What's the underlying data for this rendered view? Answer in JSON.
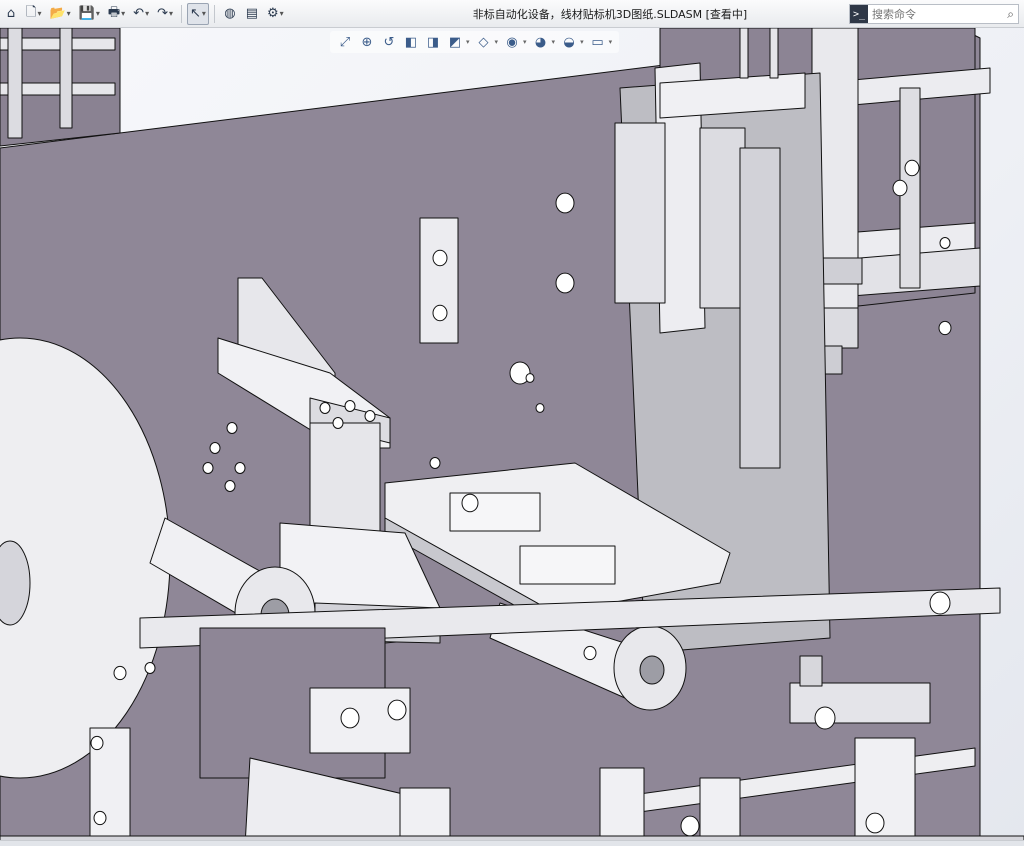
{
  "window": {
    "title": "非标自动化设备，线材贴标机3D图纸.SLDASM [查看中]"
  },
  "toolbar": {
    "items": [
      {
        "name": "home-icon",
        "glyph": "⌂",
        "caret": false
      },
      {
        "name": "new-document-icon",
        "glyph": "🗋",
        "caret": true
      },
      {
        "name": "open-folder-icon",
        "glyph": "📂",
        "caret": true
      },
      {
        "name": "save-icon",
        "glyph": "💾",
        "caret": true
      },
      {
        "name": "print-icon",
        "glyph": "🖶",
        "caret": true
      },
      {
        "name": "undo-icon",
        "glyph": "↶",
        "caret": true
      },
      {
        "name": "redo-icon",
        "glyph": "↷",
        "caret": true
      },
      {
        "name": "select-pointer-icon",
        "glyph": "↖",
        "caret": true,
        "active": true
      },
      {
        "name": "traffic-light-icon",
        "glyph": "◍",
        "caret": false
      },
      {
        "name": "file-properties-icon",
        "glyph": "▤",
        "caret": false
      },
      {
        "name": "options-gear-icon",
        "glyph": "⚙",
        "caret": true
      }
    ]
  },
  "search": {
    "placeholder": "搜索命令",
    "prompt_glyph": ">_",
    "icon": "search-icon"
  },
  "heads_up_toolbar": {
    "items": [
      {
        "name": "zoom-to-fit-icon",
        "glyph": "⤢",
        "caret": false
      },
      {
        "name": "zoom-to-area-icon",
        "glyph": "⊕",
        "caret": false
      },
      {
        "name": "previous-view-icon",
        "glyph": "↺",
        "caret": false
      },
      {
        "name": "section-view-icon",
        "glyph": "◧",
        "caret": false
      },
      {
        "name": "dynamic-annotation-icon",
        "glyph": "◨",
        "caret": false
      },
      {
        "name": "view-orientation-icon",
        "glyph": "◩",
        "caret": true
      },
      {
        "name": "display-style-icon",
        "glyph": "◇",
        "caret": true
      },
      {
        "name": "hide-show-items-icon",
        "glyph": "◉",
        "caret": true
      },
      {
        "name": "edit-appearance-icon",
        "glyph": "◕",
        "caret": true
      },
      {
        "name": "apply-scene-icon",
        "glyph": "◒",
        "caret": true
      },
      {
        "name": "view-settings-icon",
        "glyph": "▭",
        "caret": true
      }
    ]
  },
  "colors": {
    "plate": "#8f8797",
    "plate_dark": "#7b7383",
    "part_light": "#f3f3f5",
    "part_mid": "#d9d9de",
    "part_shadow": "#b9b9c0",
    "edge": "#111111",
    "accent": "#3b5c8a"
  }
}
